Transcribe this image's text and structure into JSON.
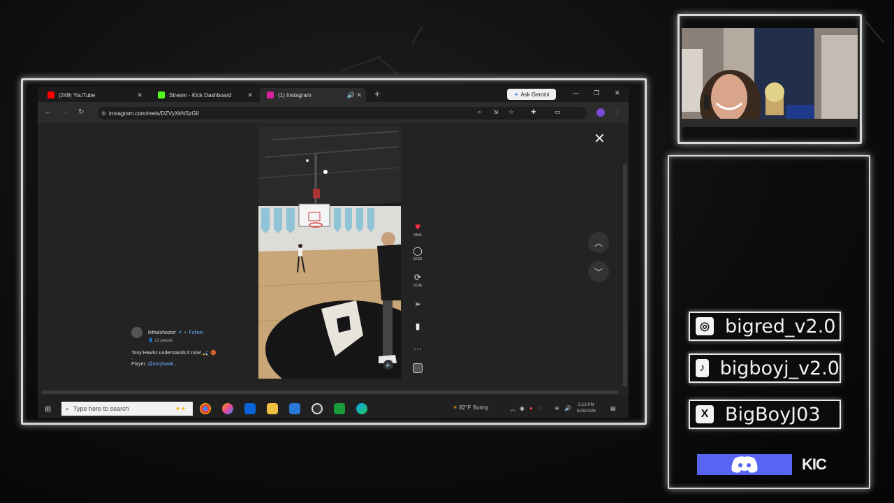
{
  "browser": {
    "tabs": [
      {
        "label": "(249) YouTube",
        "color": "#ff0000"
      },
      {
        "label": "Stream - Kick Dashboard",
        "color": "#53fc18"
      },
      {
        "label": "(1) Instagram",
        "color": "#d6249f"
      }
    ],
    "new_tab": "+",
    "gemini_label": "Ask Gemini",
    "url": "instagram.com/reels/DZVyXkNSzGI/"
  },
  "reel": {
    "likes": "449K",
    "comments": "10.5K",
    "reposts": "16.9K",
    "username": "lethalshooter",
    "follow": "Follow",
    "audience": "12 people",
    "caption": "Tony Hawks understands it now! 🏑 🏀",
    "player_label": "Player:",
    "player_mention": "@tonyhawk..."
  },
  "taskbar": {
    "search_placeholder": "Type here to search",
    "weather": "82°F  Sunny",
    "time": "5:13 PM",
    "date": "8/25/2026"
  },
  "overlay": {
    "socials": [
      {
        "icon": "instagram-icon",
        "glyph": "◎",
        "name": "bigred_v2.0"
      },
      {
        "icon": "tiktok-icon",
        "glyph": "♪",
        "name": "bigboyj_v2.0"
      },
      {
        "icon": "x-icon",
        "glyph": "X",
        "name": "BigBoyJ03"
      }
    ],
    "kick": "KIC",
    "discord_color": "#5865f2"
  }
}
